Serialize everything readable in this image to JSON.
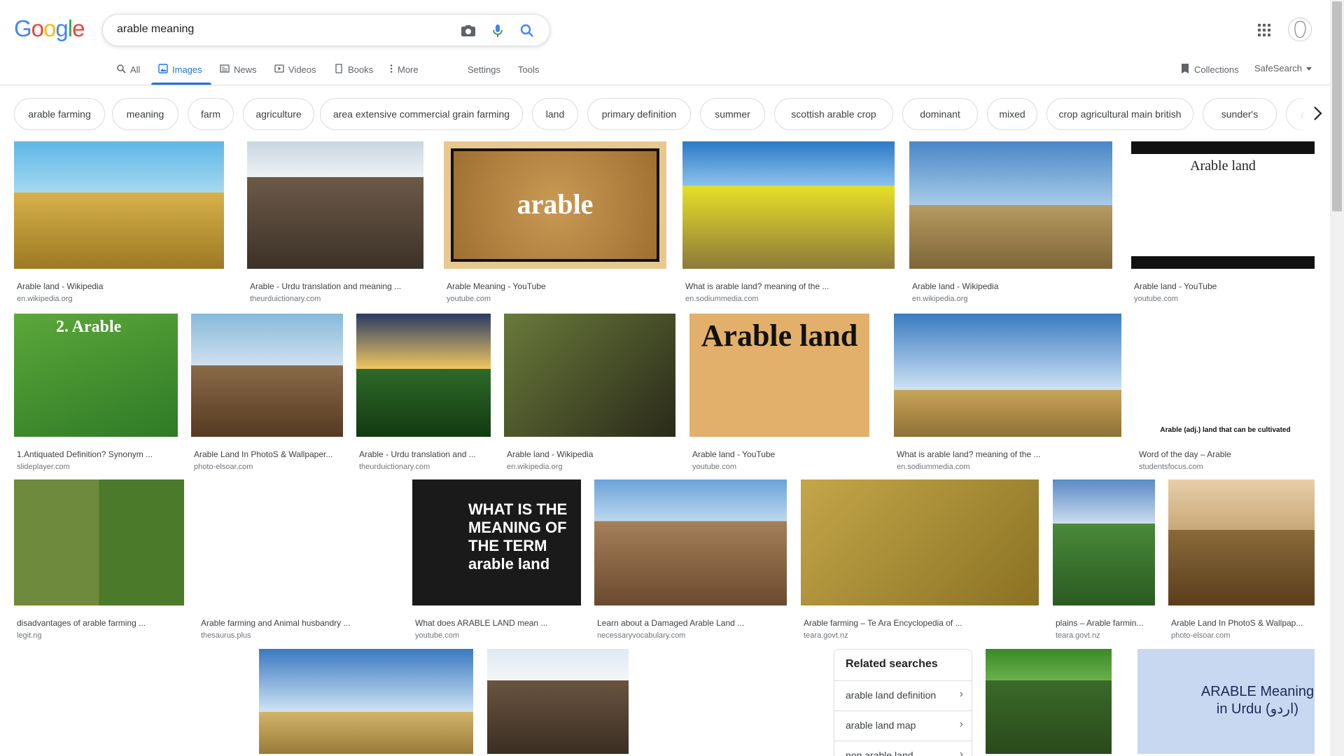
{
  "logo": [
    "G",
    "o",
    "o",
    "g",
    "l",
    "e"
  ],
  "logo_colors": [
    "#4285F4",
    "#EA4335",
    "#FBBC05",
    "#4285F4",
    "#34A853",
    "#EA4335"
  ],
  "search": {
    "query": "arable meaning"
  },
  "tabs": {
    "all": "All",
    "images": "Images",
    "news": "News",
    "videos": "Videos",
    "books": "Books",
    "more": "More",
    "settings": "Settings",
    "tools": "Tools"
  },
  "right_tools": {
    "collections": "Collections",
    "safesearch": "SafeSearch"
  },
  "chips": [
    "arable farming",
    "meaning",
    "farm",
    "agriculture",
    "area extensive commercial grain farming",
    "land",
    "primary definition",
    "summer",
    "scottish arable crop",
    "dominant",
    "mixed",
    "crop agricultural main british",
    "sunder's",
    "agricultur"
  ],
  "results": [
    {
      "title": "Arable land - Wikipedia",
      "source": "en.wikipedia.org"
    },
    {
      "title": "Arable - Urdu translation and meaning ...",
      "source": "theurduictionary.com"
    },
    {
      "title": "Arable Meaning - YouTube",
      "source": "youtube.com",
      "overlay": "arable"
    },
    {
      "title": "What is arable land? meaning of the ...",
      "source": "en.sodiummedia.com"
    },
    {
      "title": "Arable land - Wikipedia",
      "source": "en.wikipedia.org"
    },
    {
      "title": "Arable land - YouTube",
      "source": "youtube.com",
      "overlay": "Arable land"
    },
    {
      "title": "1.Antiquated Definition? Synonym ...",
      "source": "slideplayer.com",
      "overlay": "2. Arable"
    },
    {
      "title": "Arable Land In PhotoS & Wallpaper...",
      "source": "photo-elsoar.com"
    },
    {
      "title": "Arable - Urdu translation and ...",
      "source": "theurduictionary.com"
    },
    {
      "title": "Arable land - Wikipedia",
      "source": "en.wikipedia.org"
    },
    {
      "title": "Arable land - YouTube",
      "source": "youtube.com",
      "overlay": "Arable land"
    },
    {
      "title": "What is arable land? meaning of the ...",
      "source": "en.sodiummedia.com"
    },
    {
      "title": "Word of the day – Arable",
      "source": "studentsfocus.com",
      "overlay": "Arable (adj.) land that can be cultivated"
    },
    {
      "title": "disadvantages of arable farming ...",
      "source": "legit.ng"
    },
    {
      "title": "Arable farming and Animal husbandry ...",
      "source": "thesaurus.plus"
    },
    {
      "title": "What does ARABLE LAND mean ...",
      "source": "youtube.com",
      "overlay": "WHAT IS THE MEANING OF THE TERM arable land"
    },
    {
      "title": "Learn about a Damaged Arable Land ...",
      "source": "necessaryvocabulary.com"
    },
    {
      "title": "Arable farming – Te Ara Encyclopedia of ...",
      "source": "teara.govt.nz"
    },
    {
      "title": "plains – Arable farmin...",
      "source": "teara.govt.nz"
    },
    {
      "title": "Arable Land In PhotoS & Wallpap...",
      "source": "photo-elsoar.com"
    },
    {
      "title": "",
      "source": ""
    },
    {
      "title": "",
      "source": ""
    },
    {
      "title": "",
      "source": ""
    },
    {
      "title": "",
      "source": ""
    },
    {
      "title": "",
      "source": ""
    },
    {
      "title": "",
      "source": "",
      "overlay": "ARABLE Meaning in Urdu (اردو)"
    }
  ],
  "related": {
    "heading": "Related searches",
    "items": [
      "arable land definition",
      "arable land map",
      "non arable land"
    ]
  },
  "colors": {
    "accent": "#1a73e8",
    "muted": "#70757a",
    "border": "#dadce0"
  }
}
